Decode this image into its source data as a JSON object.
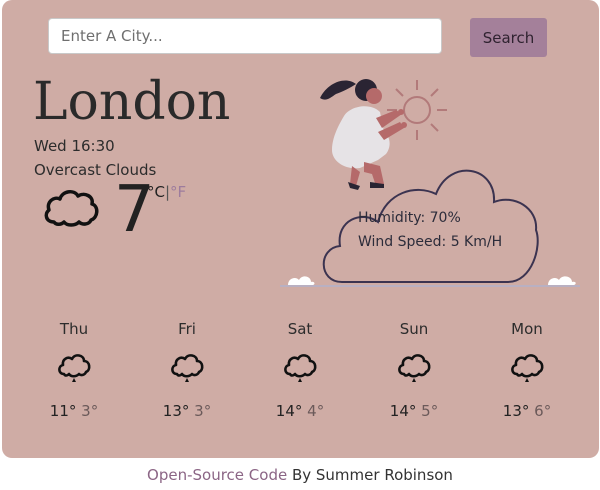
{
  "search": {
    "placeholder": "Enter A City...",
    "button_label": "Search"
  },
  "current": {
    "city": "London",
    "datetime": "Wed 16:30",
    "description": "Overcast Clouds",
    "temperature": "7",
    "unit_c": "°C",
    "unit_sep": "|",
    "unit_f": "°F",
    "icon": "cloud-icon",
    "humidity": "Humidity: 70%",
    "wind": "Wind Speed: 5 Km/H"
  },
  "forecast": [
    {
      "day": "Thu",
      "max": "11°",
      "min": "3°",
      "icon": "rain-cloud-icon"
    },
    {
      "day": "Fri",
      "max": "13°",
      "min": "3°",
      "icon": "rain-cloud-icon"
    },
    {
      "day": "Sat",
      "max": "14°",
      "min": "4°",
      "icon": "rain-cloud-icon"
    },
    {
      "day": "Sun",
      "max": "14°",
      "min": "5°",
      "icon": "rain-cloud-icon"
    },
    {
      "day": "Mon",
      "max": "13°",
      "min": "6°",
      "icon": "rain-cloud-icon"
    }
  ],
  "footer": {
    "link_text": "Open-Source Code",
    "by_text": " By Summer Robinson"
  },
  "colors": {
    "background": "#cfaca5",
    "button": "#a4809a",
    "link": "#8b6585"
  }
}
